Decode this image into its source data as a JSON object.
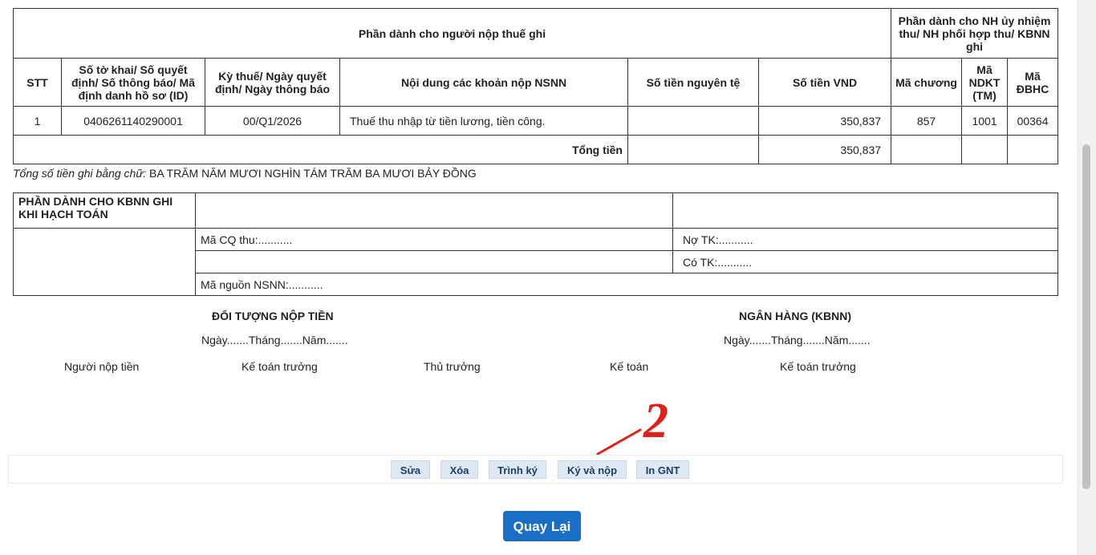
{
  "table": {
    "header_left": "Phần dành cho người nộp thuế ghi",
    "header_right": "Phần dành cho NH ủy nhiệm thu/ NH phối hợp thu/ KBNN ghi",
    "columns": [
      "STT",
      "Số tờ khai/ Số quyết định/ Số thông báo/ Mã định danh hồ sơ (ID)",
      "Kỳ thuế/ Ngày quyết định/ Ngày thông báo",
      "Nội dung các khoản nộp NSNN",
      "Số tiền nguyên tệ",
      "Số tiền VND",
      "Mã chương",
      "Mã NDKT (TM)",
      "Mã ĐBHC"
    ],
    "row": {
      "stt": "1",
      "so_to_khai": "0406261140290001",
      "ky_thue": "00/Q1/2026",
      "noi_dung": "Thuế thu nhập từ tiền lương, tiền công.",
      "so_tien_nguyen_te": "",
      "so_tien_vnd": "350,837",
      "ma_chuong": "857",
      "ma_ndkt": "1001",
      "ma_dbhc": "00364"
    },
    "total_label": "Tổng tiền",
    "total_vnd": "350,837"
  },
  "amount_words": {
    "label": "Tổng số tiền ghi bằng chữ:",
    "value": " BA TRĂM NĂM MƯƠI NGHÌN TÁM TRĂM BA MƯƠI BẢY ĐỒNG"
  },
  "kbnn": {
    "header": "PHẦN DÀNH CHO KBNN GHI KHI HẠCH TOÁN",
    "ma_cq_thu": "Mã CQ thu:...........",
    "no_tk": "Nợ TK:...........",
    "co_tk": "Có TK:...........",
    "ma_nguon": "Mã nguồn NSNN:..........."
  },
  "signatures": {
    "payer_title": "ĐỐI TƯỢNG NỘP TIỀN",
    "bank_title": "NGÂN HÀNG (KBNN)",
    "date_left": "Ngày.......Tháng.......Năm.......",
    "date_right": "Ngày.......Tháng.......Năm.......",
    "nguoi_nop": "Người nộp tiền",
    "ke_toan_truong_1": "Kế toán trưởng",
    "thu_truong": "Thủ trưởng",
    "ke_toan": "Kế toán",
    "ke_toan_truong_2": "Kế toán trưởng"
  },
  "annotation": {
    "number": "2",
    "color": "#e0201b"
  },
  "toolbar": {
    "sua": "Sửa",
    "xoa": "Xóa",
    "trinh_ky": "Trình ký",
    "ky_va_nop": "Ký và nộp",
    "in_gnt": "In GNT"
  },
  "back_button": "Quay Lại",
  "colors": {
    "primary": "#1a6fc4",
    "toolbar_button": "#dde8f3"
  }
}
